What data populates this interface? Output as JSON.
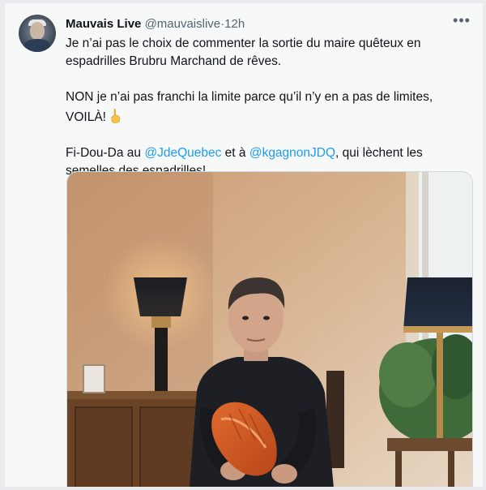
{
  "tweet": {
    "display_name": "Mauvais Live",
    "handle": "@mauvaislive",
    "separator": "·",
    "time": "12h",
    "more_label": "•••",
    "paragraph1": "Je n’ai pas le choix de commenter la sortie du maire quêteux en espadrilles Brubru Marchand de rêves.",
    "paragraph2": "NON je n’ai pas franchi la limite parce qu’il n’y en a pas de limites, VOILÀ!",
    "paragraph3_prefix": "Fi-Dou-Da au ",
    "mention1": "@JdeQuebec",
    "paragraph3_middle": " et à ",
    "mention2": "@kgagnonJDQ",
    "paragraph3_suffix": ", qui lèchent les semelles des espadrilles!",
    "emoji": "pointing-finger-emoji"
  },
  "colors": {
    "text": "#0f1419",
    "secondary": "#536471",
    "link": "#1d9bf0",
    "background": "#f7f9f9"
  }
}
